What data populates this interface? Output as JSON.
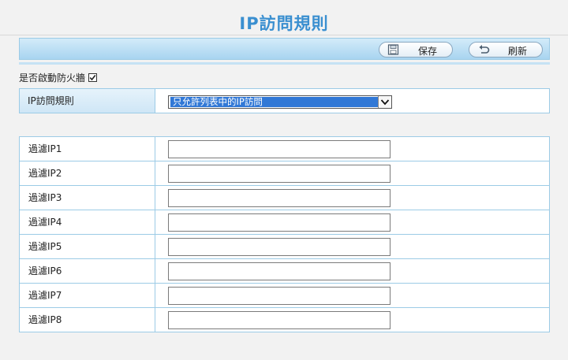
{
  "page": {
    "title": "IP訪問規則"
  },
  "toolbar": {
    "save_label": "保存",
    "refresh_label": "刷新"
  },
  "firewall": {
    "label": "是否啟動防火牆",
    "checked": true
  },
  "rule": {
    "label": "IP訪問規則",
    "selected": "只允許列表中的IP訪問"
  },
  "filters": [
    {
      "label": "過濾IP1",
      "value": ""
    },
    {
      "label": "過濾IP2",
      "value": ""
    },
    {
      "label": "過濾IP3",
      "value": ""
    },
    {
      "label": "過濾IP4",
      "value": ""
    },
    {
      "label": "過濾IP5",
      "value": ""
    },
    {
      "label": "過濾IP6",
      "value": ""
    },
    {
      "label": "過濾IP7",
      "value": ""
    },
    {
      "label": "過濾IP8",
      "value": ""
    }
  ],
  "colors": {
    "title": "#3a8fd0",
    "toolbar": "#a8d4f0",
    "border": "#9ccbe6",
    "selection": "#3178d6"
  }
}
